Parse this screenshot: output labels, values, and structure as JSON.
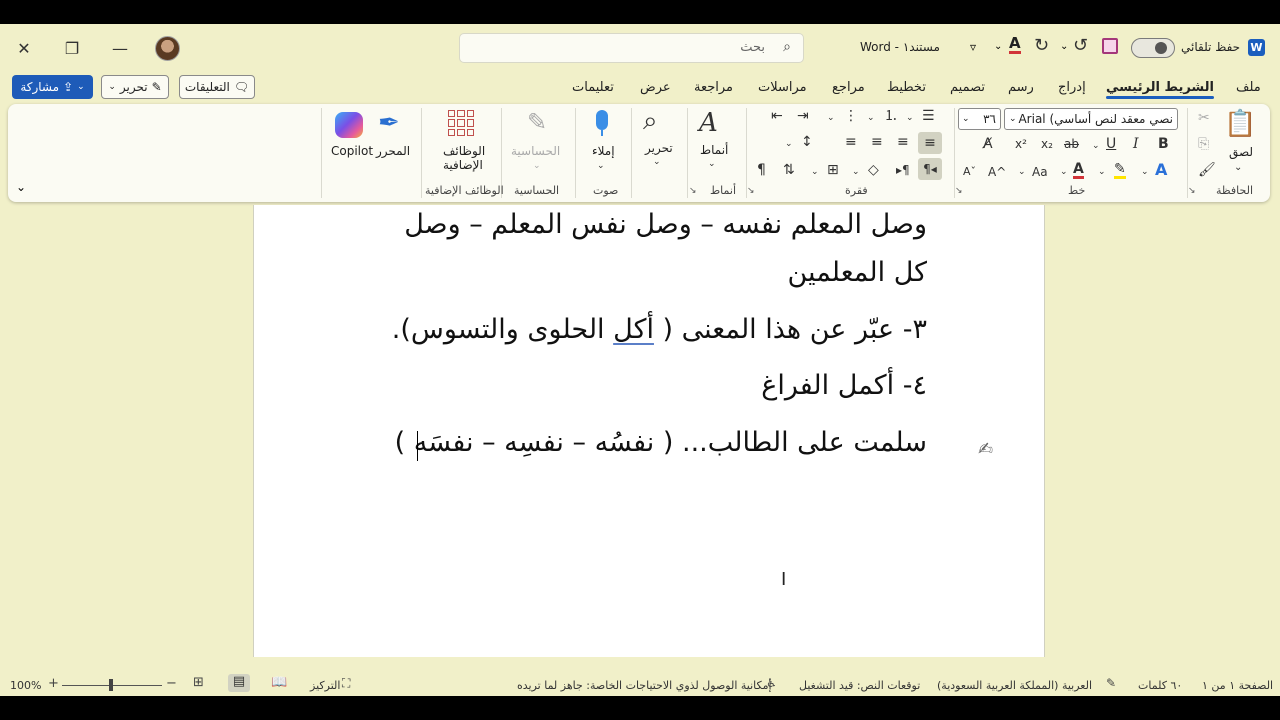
{
  "titlebar": {
    "autosave_label": "حفظ تلقائي",
    "doc_title": "مستند١ - Word",
    "search_placeholder": "بحث"
  },
  "tabs": [
    "ملف",
    "الشريط الرئيسي",
    "إدراج",
    "رسم",
    "تصميم",
    "تخطيط",
    "مراجع",
    "مراسلات",
    "مراجعة",
    "عرض",
    "تعليمات"
  ],
  "active_tab": "الشريط الرئيسي",
  "actions": {
    "comments": "التعليقات",
    "edit": "تحرير",
    "share": "مشاركة"
  },
  "ribbon": {
    "clipboard": {
      "paste": "لصق",
      "group": "الحافظة"
    },
    "font": {
      "name": "نصي معقد لنص أساسي) Arial",
      "size": "٣٦",
      "group": "خط",
      "bold": "B",
      "italic": "I",
      "underline": "U",
      "strike": "ab",
      "sub": "x₂",
      "sup": "x²",
      "case": "Aa",
      "grow": "A^",
      "shrink": "Aˇ"
    },
    "paragraph": {
      "group": "فقرة"
    },
    "styles": {
      "label": "أنماط",
      "group": "أنماط"
    },
    "editing": {
      "label": "تحرير"
    },
    "voice": {
      "label": "إملاء",
      "group": "صوت"
    },
    "sensitivity": {
      "label": "الحساسية",
      "group": "الحساسية"
    },
    "addins": {
      "label_line1": "الوظائف",
      "label_line2": "الإضافية",
      "group": "الوظائف الإضافية"
    },
    "editor": {
      "label": "المحرر"
    },
    "copilot": {
      "label": "Copilot"
    }
  },
  "document": {
    "lines": [
      "وصل المعلم نفسه – وصل نفس المعلم – وصل",
      "كل المعلمين",
      "٣- عبّر عن هذا المعنى ( أكل الحلوى والتسوس).",
      "٤- أكمل الفراغ",
      "سلمت على الطالب... ( نفسُه – نفسِه – نفسَه )"
    ],
    "line3_parts": [
      "٣- عبّر عن هذا المعنى ( ",
      "أكل",
      " الحلوى والتسوس)."
    ]
  },
  "statusbar": {
    "page": "الصفحة ١ من ١",
    "words": "٦٠ كلمات",
    "language": "العربية (المملكة العربية السعودية)",
    "predictions": "توقعات النص: قيد التشغيل",
    "accessibility": "إمكانية الوصول لذوي الاحتياجات الخاصة: جاهز لما تريده",
    "focus": "التركيز",
    "zoom": "100%"
  },
  "colors": {
    "accent": "#1b5ebe",
    "background": "#f1f0c9",
    "font_color_red": "#d13438",
    "highlight_yellow": "#ffe500"
  }
}
